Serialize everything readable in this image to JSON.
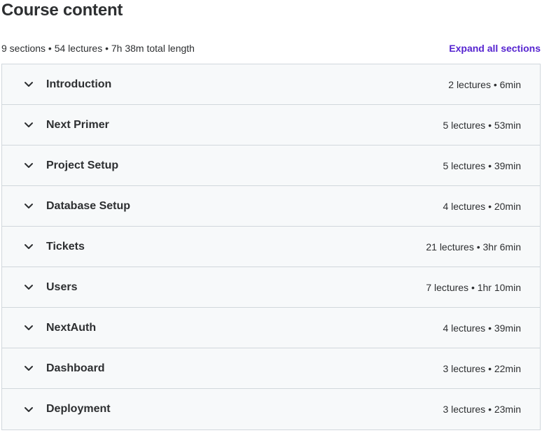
{
  "course_content": {
    "title": "Course content",
    "summary": "9 sections • 54 lectures • 7h 38m total length",
    "expand_all_label": "Expand all sections",
    "accent_color": "#5624d0",
    "sections": [
      {
        "title": "Introduction",
        "meta": "2 lectures • 6min"
      },
      {
        "title": "Next Primer",
        "meta": "5 lectures • 53min"
      },
      {
        "title": "Project Setup",
        "meta": "5 lectures • 39min"
      },
      {
        "title": "Database Setup",
        "meta": "4 lectures • 20min"
      },
      {
        "title": "Tickets",
        "meta": "21 lectures • 3hr 6min"
      },
      {
        "title": "Users",
        "meta": "7 lectures • 1hr 10min"
      },
      {
        "title": "NextAuth",
        "meta": "4 lectures • 39min"
      },
      {
        "title": "Dashboard",
        "meta": "3 lectures • 22min"
      },
      {
        "title": "Deployment",
        "meta": "3 lectures • 23min"
      }
    ]
  }
}
